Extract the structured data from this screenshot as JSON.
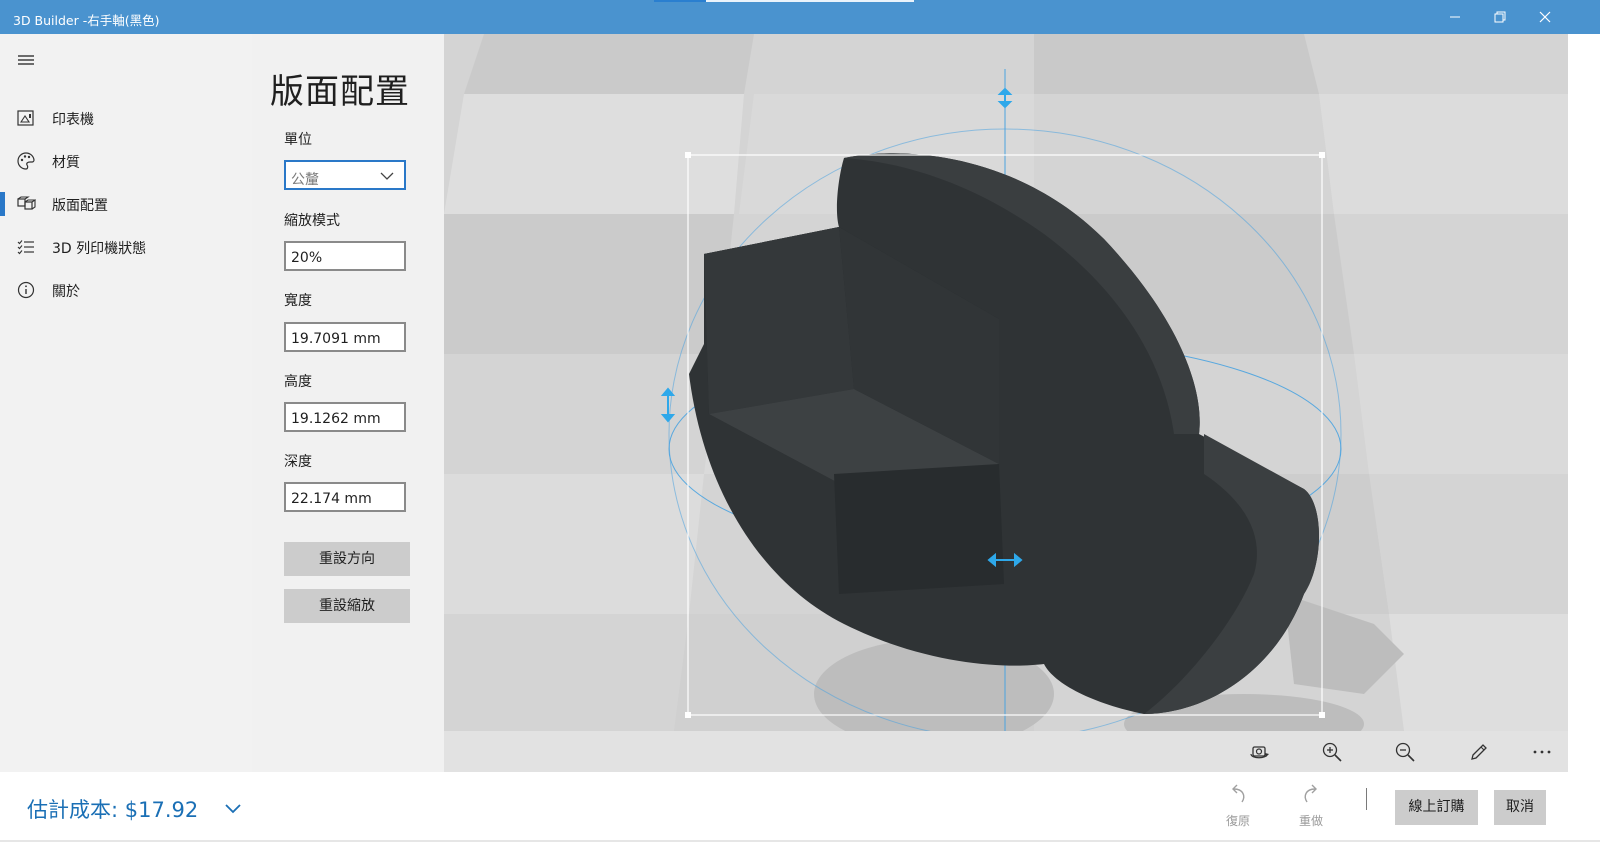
{
  "window": {
    "title": "3D Builder -右手軸(黑色)",
    "accent_color": "#4a93cf"
  },
  "sidebar": {
    "items": [
      {
        "label": "印表機",
        "icon": "printer-icon",
        "active": false
      },
      {
        "label": "材質",
        "icon": "palette-icon",
        "active": false
      },
      {
        "label": "版面配置",
        "icon": "layout-icon",
        "active": true
      },
      {
        "label": "3D 列印機狀態",
        "icon": "checklist-icon",
        "active": false
      },
      {
        "label": "關於",
        "icon": "info-icon",
        "active": false
      }
    ]
  },
  "panel": {
    "heading": "版面配置",
    "unit_label": "單位",
    "unit_value": "公釐",
    "scale_label": "縮放模式",
    "scale_value": "20%",
    "width_label": "寬度",
    "width_value": "19.7091 mm",
    "height_label": "高度",
    "height_value": "19.1262 mm",
    "depth_label": "深度",
    "depth_value": "22.174 mm",
    "reset_orientation": "重設方向",
    "reset_scale": "重設縮放"
  },
  "toolbar": {
    "icons": [
      "orbit-camera-icon",
      "zoom-in-icon",
      "zoom-out-icon",
      "edit-pencil-icon",
      "more-icon"
    ]
  },
  "bottom": {
    "cost_label": "估計成本: $17.92",
    "undo_label": "復原",
    "redo_label": "重做",
    "order_online": "線上訂購",
    "cancel": "取消"
  }
}
